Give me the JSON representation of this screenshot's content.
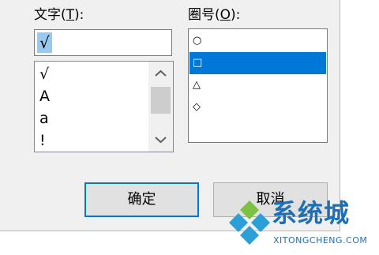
{
  "dialog": {
    "text_label": "文字(T):",
    "text_label_pre": "文字(",
    "text_label_key": "T",
    "text_label_post": "):",
    "bullet_label_pre": "圈号(",
    "bullet_label_key": "O",
    "bullet_label_post": "):",
    "text_value": "√",
    "char_list": [
      "√",
      "A",
      "a",
      "!"
    ],
    "bullet_list": [
      "○",
      "□",
      "△",
      "◇"
    ],
    "bullet_selected": "□",
    "ok_label": "确定",
    "cancel_label": "取消"
  },
  "watermark": {
    "title": "系统城",
    "subtitle": "XITONGCHENG.COM"
  },
  "colors": {
    "selection": "#0078d7",
    "text_selection": "#99c9ef",
    "watermark": "#1f6fb5"
  }
}
